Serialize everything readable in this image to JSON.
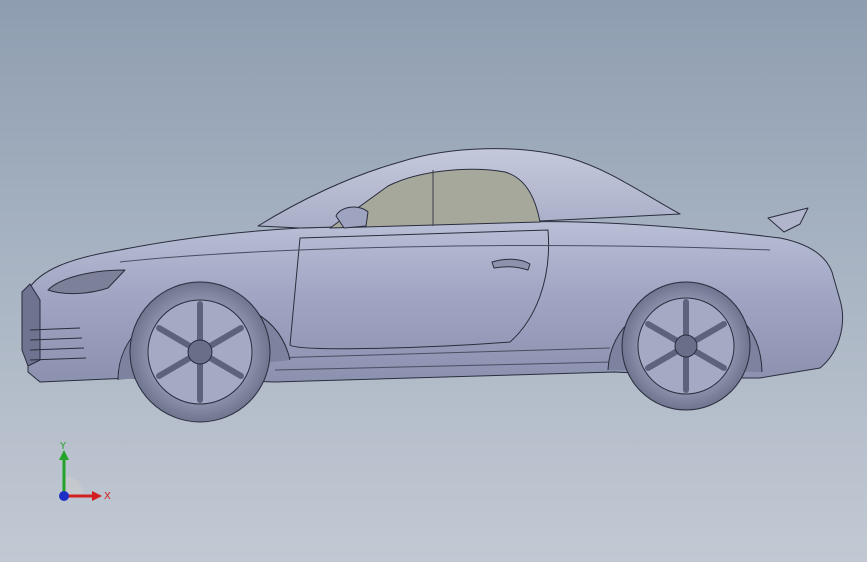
{
  "viewport": {
    "model": "car-side-view",
    "colors": {
      "background_top": "#8e9db0",
      "background_bottom": "#c2c9d3",
      "body": "#a3a9c4",
      "body_dark": "#7f86a4",
      "glass": "#a6a89c",
      "line": "#2a2d3d",
      "tire": "#8e93ad"
    }
  },
  "triad": {
    "x_label": "X",
    "y_label": "Y",
    "x_color": "#d21f1f",
    "y_color": "#23a32a",
    "z_color": "#1d2fc4"
  }
}
